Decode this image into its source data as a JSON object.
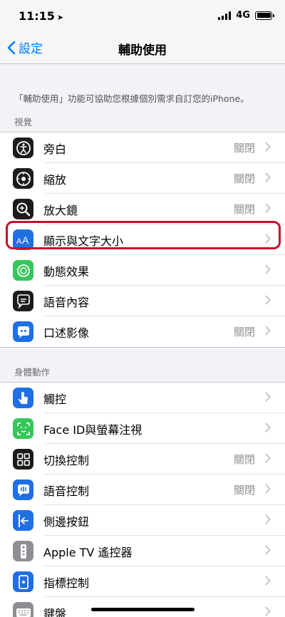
{
  "status": {
    "time": "11:15",
    "network": "4G"
  },
  "nav": {
    "back_label": "設定",
    "title": "輔助使用"
  },
  "description": "「輔助使用」功能可協助您根據個別需求自訂您的iPhone。",
  "vision": {
    "header": "視覺",
    "items": [
      {
        "label": "旁白",
        "value": "關閉",
        "icon": "voiceover-icon",
        "color": "#1c1c1e"
      },
      {
        "label": "縮放",
        "value": "關閉",
        "icon": "zoom-icon",
        "color": "#1c1c1e"
      },
      {
        "label": "放大鏡",
        "value": "關閉",
        "icon": "magnifier-icon",
        "color": "#1c1c1e"
      },
      {
        "label": "顯示與文字大小",
        "value": "",
        "icon": "text-size-icon",
        "color": "#1f6fe5"
      },
      {
        "label": "動態效果",
        "value": "",
        "icon": "motion-icon",
        "color": "#34c759"
      },
      {
        "label": "語音內容",
        "value": "",
        "icon": "spoken-content-icon",
        "color": "#1c1c1e"
      },
      {
        "label": "口述影像",
        "value": "關閉",
        "icon": "audio-description-icon",
        "color": "#1f6fe5"
      }
    ]
  },
  "physical": {
    "header": "身體動作",
    "items": [
      {
        "label": "觸控",
        "value": "",
        "icon": "touch-icon",
        "color": "#1f6fe5"
      },
      {
        "label": "Face ID與螢幕注視",
        "value": "",
        "icon": "face-id-icon",
        "color": "#34c759"
      },
      {
        "label": "切換控制",
        "value": "關閉",
        "icon": "switch-control-icon",
        "color": "#1c1c1e"
      },
      {
        "label": "語音控制",
        "value": "關閉",
        "icon": "voice-control-icon",
        "color": "#1f6fe5"
      },
      {
        "label": "側邊按鈕",
        "value": "",
        "icon": "side-button-icon",
        "color": "#1f6fe5"
      },
      {
        "label": "Apple TV 遙控器",
        "value": "",
        "icon": "apple-tv-remote-icon",
        "color": "#8e8e93"
      },
      {
        "label": "指標控制",
        "value": "",
        "icon": "pointer-control-icon",
        "color": "#1f6fe5"
      },
      {
        "label": "鍵盤",
        "value": "",
        "icon": "keyboard-icon",
        "color": "#8e8e93"
      }
    ]
  }
}
